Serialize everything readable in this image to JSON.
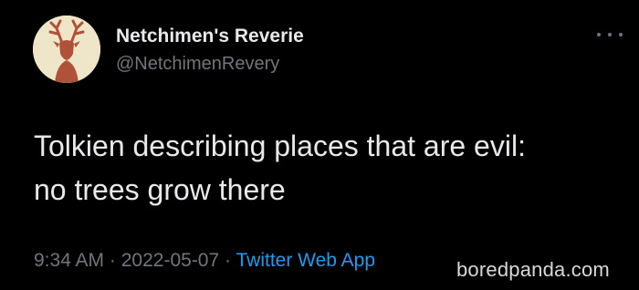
{
  "tweet": {
    "display_name": "Netchimen's Reverie",
    "handle": "@NetchimenRevery",
    "text": "Tolkien describing places that are evil:\nno trees grow there",
    "time": "9:34 AM",
    "separator": "·",
    "date": "2022-05-07",
    "source": "Twitter Web App",
    "more_icon": "more-horizontal-icon",
    "avatar_icon": "stag-avatar"
  },
  "watermark": "boredpanda.com",
  "colors": {
    "background": "#000000",
    "primary_text": "#e7e9ea",
    "secondary_text": "#71767b",
    "link": "#1d9bf0",
    "avatar_bg": "#efe5c8",
    "avatar_figure": "#b0523a"
  }
}
